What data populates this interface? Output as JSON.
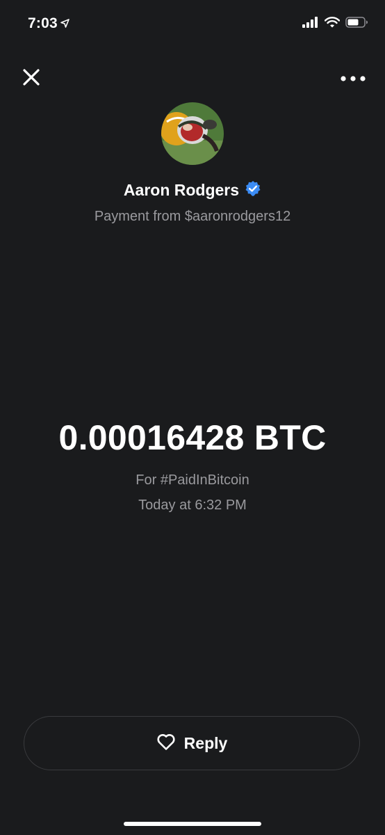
{
  "status_bar": {
    "time": "7:03",
    "icons": [
      "location-arrow-icon",
      "signal-icon",
      "wifi-icon",
      "battery-icon"
    ]
  },
  "top_bar": {
    "close_icon": "close-icon",
    "more_icon": "more-icon"
  },
  "payment": {
    "sender_name": "Aaron Rodgers",
    "verified_icon": "verified-badge-icon",
    "subtitle": "Payment from $aaronrodgers12",
    "amount": "0.00016428 BTC",
    "note": "For #PaidInBitcoin",
    "timestamp": "Today at 6:32 PM"
  },
  "actions": {
    "reply_label": "Reply",
    "reply_icon": "heart-icon"
  },
  "colors": {
    "background": "#1a1b1d",
    "text_primary": "#ffffff",
    "text_secondary": "#9a9a9e",
    "verified_blue": "#3b8cf5",
    "button_border": "#3a3b3e"
  }
}
